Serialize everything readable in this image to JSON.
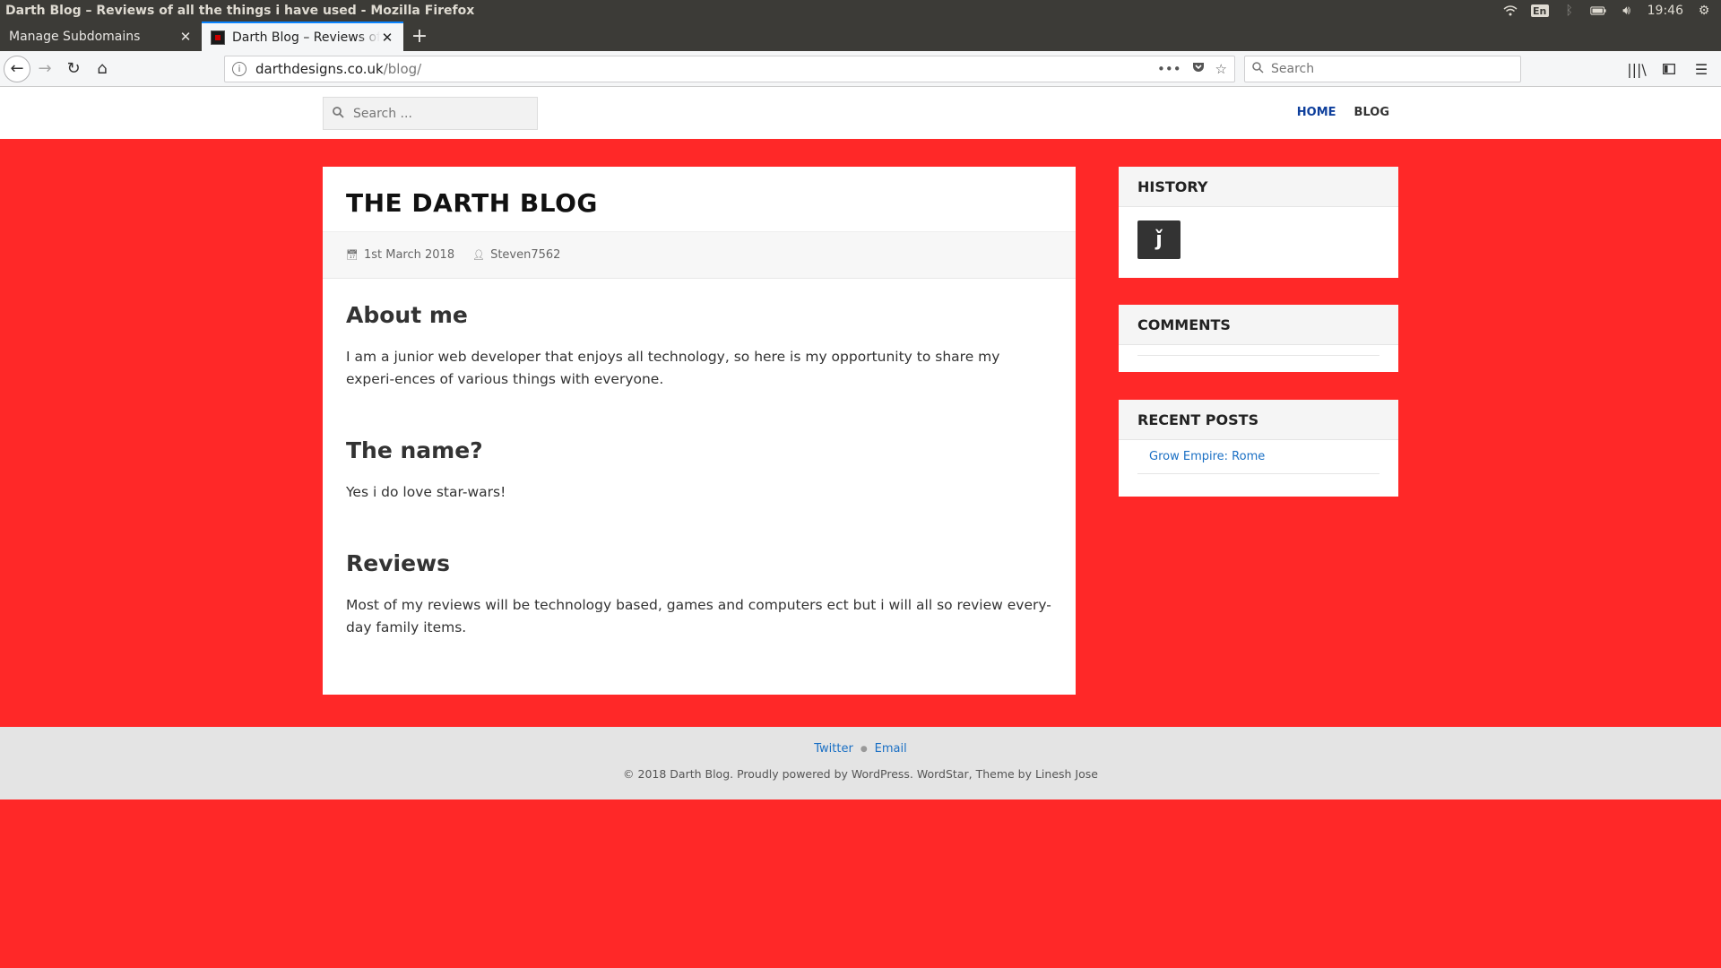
{
  "os": {
    "window_title": "Darth Blog – Reviews of all the things i have used - Mozilla Firefox",
    "lang": "En",
    "time": "19:46"
  },
  "browser": {
    "tabs": [
      {
        "label": "Manage Subdomains",
        "active": false
      },
      {
        "label": "Darth Blog – Reviews of all the things i have used",
        "active": true
      }
    ],
    "url_host": "darthdesigns.co.uk",
    "url_path": "/blog/",
    "search_placeholder": "Search"
  },
  "site": {
    "search_placeholder": "Search ...",
    "nav": [
      {
        "label": "HOME",
        "current": true
      },
      {
        "label": "BLOG",
        "current": false
      }
    ]
  },
  "post": {
    "title": "THE DARTH BLOG",
    "date": "1st March 2018",
    "author": "Steven7562",
    "sections": [
      {
        "heading": "About me",
        "text": "I am a junior web developer that enjoys all technology, so here is my opportunity to share my experi-ences of various things with everyone."
      },
      {
        "heading": "The name?",
        "text": "Yes i do love star-wars!"
      },
      {
        "heading": "Reviews",
        "text": "Most of my reviews will be technology based, games and computers ect but i will all so review every-day family items."
      }
    ]
  },
  "sidebar": {
    "history_title": "HISTORY",
    "history_icon_glyph": "ǰ",
    "comments_title": "COMMENTS",
    "recent_title": "RECENT POSTS",
    "recent_posts": [
      "Grow Empire: Rome"
    ]
  },
  "footer": {
    "links": [
      "Twitter",
      "Email"
    ],
    "copyright": "© 2018 Darth Blog. Proudly powered by WordPress. WordStar, Theme by Linesh Jose"
  },
  "colors": {
    "page_bg": "#ff2828",
    "nav_current": "#0e3f9c",
    "link": "#1a6fc4"
  }
}
